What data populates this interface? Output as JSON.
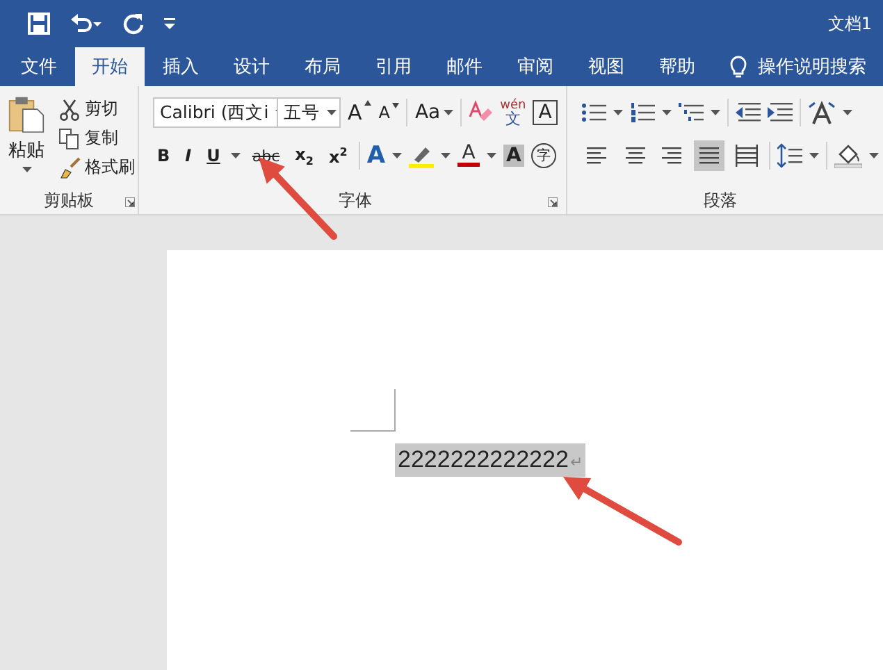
{
  "window": {
    "title": "文档1"
  },
  "tabs": [
    {
      "label": "文件",
      "selected": false
    },
    {
      "label": "开始",
      "selected": true
    },
    {
      "label": "插入",
      "selected": false
    },
    {
      "label": "设计",
      "selected": false
    },
    {
      "label": "布局",
      "selected": false
    },
    {
      "label": "引用",
      "selected": false
    },
    {
      "label": "邮件",
      "selected": false
    },
    {
      "label": "审阅",
      "selected": false
    },
    {
      "label": "视图",
      "selected": false
    },
    {
      "label": "帮助",
      "selected": false
    }
  ],
  "tell_me": {
    "label": "操作说明搜索"
  },
  "clipboard": {
    "name": "剪贴板",
    "paste": "粘贴",
    "actions": [
      {
        "kind": "cut",
        "label": "剪切"
      },
      {
        "kind": "copy",
        "label": "复制"
      },
      {
        "kind": "painter",
        "label": "格式刷"
      }
    ]
  },
  "font": {
    "name": "字体",
    "font_name": "Calibri (西文i",
    "font_size": "五号",
    "grow": "A",
    "shrink": "A",
    "change_case": "Aa",
    "phonetic_top": "wén",
    "phonetic_bottom": "文",
    "border_char": "A",
    "format_buttons": [
      {
        "label": "B",
        "kind": "bold"
      },
      {
        "label": "I",
        "kind": "italic"
      },
      {
        "label": "U",
        "kind": "underline"
      },
      {
        "label": "abc",
        "kind": "strike"
      },
      {
        "label": "x$_{2}$",
        "kind": "sub"
      },
      {
        "label": "x$^{2}$",
        "kind": "sup"
      }
    ],
    "text_effect_char": "A",
    "font_color_char": "A",
    "shading_char": "A",
    "enclose_char": "字"
  },
  "paragraph": {
    "name": "段落",
    "alignment_buttons": [
      {
        "kind": "left",
        "selected": false
      },
      {
        "kind": "center",
        "selected": false
      },
      {
        "kind": "right",
        "selected": false
      },
      {
        "kind": "justify",
        "selected": true
      },
      {
        "kind": "distributed",
        "selected": false
      }
    ]
  },
  "document": {
    "text": "2222222222222",
    "selected": true,
    "paragraph_mark": "↵"
  }
}
